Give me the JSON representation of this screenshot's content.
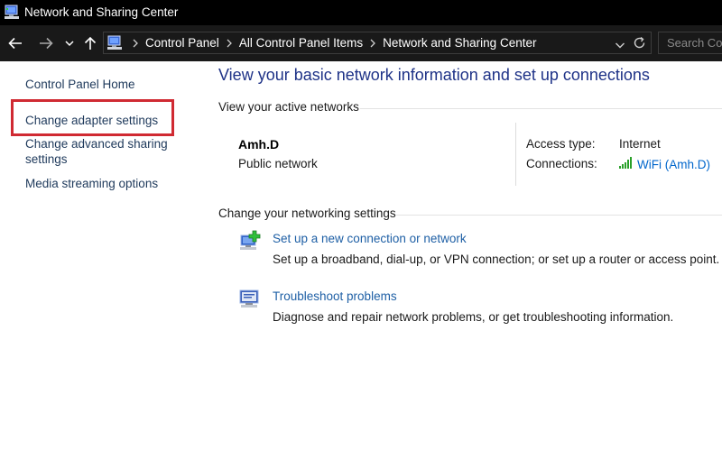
{
  "window": {
    "title": "Network and Sharing Center"
  },
  "address": {
    "breadcrumbs": [
      "Control Panel",
      "All Control Panel Items",
      "Network and Sharing Center"
    ],
    "search_placeholder": "Search Co"
  },
  "sidebar": {
    "items": [
      {
        "label": "Control Panel Home"
      },
      {
        "label": "Change adapter settings",
        "highlighted": true
      },
      {
        "label_line1": "Change advanced sharing",
        "label_line2": "settings"
      },
      {
        "label": "Media streaming options"
      }
    ],
    "highlight_color": "#d02a32"
  },
  "main": {
    "title": "View your basic network information and set up connections",
    "active_networks": {
      "heading": "View your active networks",
      "network_name": "Amh.D",
      "network_category": "Public network",
      "access_type_label": "Access type:",
      "access_type_value": "Internet",
      "connections_label": "Connections:",
      "connection_name": "WiFi (Amh.D)"
    },
    "change_settings": {
      "heading": "Change your networking settings",
      "tasks": [
        {
          "icon": "new-connection-icon",
          "link": "Set up a new connection or network",
          "description": "Set up a broadband, dial-up, or VPN connection; or set up a router or access point."
        },
        {
          "icon": "troubleshoot-icon",
          "link": "Troubleshoot problems",
          "description": "Diagnose and repair network problems, or get troubleshooting information."
        }
      ]
    }
  },
  "colors": {
    "title_bar": "#000000",
    "address_bar": "#191919",
    "link": "#1e395b",
    "heading": "#1e3287",
    "wifi": "#2aa02a"
  }
}
